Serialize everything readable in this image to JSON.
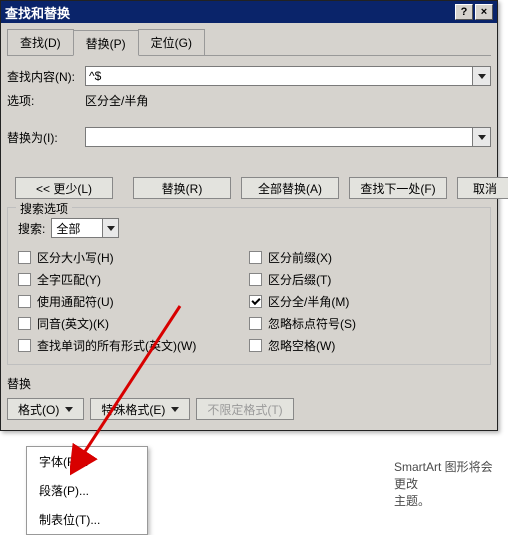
{
  "titlebar": {
    "title": "查找和替换"
  },
  "tabs": {
    "find": "查找(D)",
    "replace": "替换(P)",
    "goto": "定位(G)"
  },
  "find_content": {
    "label": "查找内容(N):",
    "value": "^$"
  },
  "options_line": {
    "label": "选项:",
    "value": "区分全/半角"
  },
  "replace_with": {
    "label": "替换为(I):",
    "value": ""
  },
  "buttons": {
    "less": "<< 更少(L)",
    "replace": "替换(R)",
    "replace_all": "全部替换(A)",
    "find_next": "查找下一处(F)",
    "cancel": "取消"
  },
  "search_options": {
    "legend": "搜索选项",
    "search_label": "搜索:",
    "search_value": "全部",
    "left": [
      {
        "label": "区分大小写(H)",
        "checked": false
      },
      {
        "label": "全字匹配(Y)",
        "checked": false
      },
      {
        "label": "使用通配符(U)",
        "checked": false
      },
      {
        "label": "同音(英文)(K)",
        "checked": false
      },
      {
        "label": "查找单词的所有形式(英文)(W)",
        "checked": false
      }
    ],
    "right": [
      {
        "label": "区分前缀(X)",
        "checked": false
      },
      {
        "label": "区分后缀(T)",
        "checked": false
      },
      {
        "label": "区分全/半角(M)",
        "checked": true
      },
      {
        "label": "忽略标点符号(S)",
        "checked": false
      },
      {
        "label": "忽略空格(W)",
        "checked": false
      }
    ]
  },
  "replace_section": {
    "label": "替换",
    "format_btn": "格式(O)",
    "special_btn": "特殊格式(E)",
    "no_format_btn": "不限定格式(T)"
  },
  "popup": {
    "font": "字体(F)...",
    "paragraph": "段落(P)...",
    "tabs": "制表位(T)..."
  },
  "background": {
    "line1": "SmartArt 图形将会更改",
    "line2": "主题。"
  }
}
